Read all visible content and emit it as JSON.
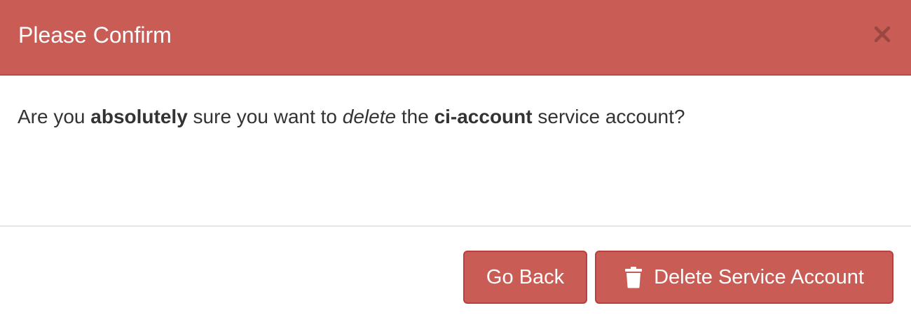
{
  "modal": {
    "title": "Please Confirm",
    "close_icon": "close-icon",
    "message": {
      "part1": "Are you ",
      "emphasis_strong": "absolutely",
      "part2": " sure you want to ",
      "emphasis_italic": "delete",
      "part3": " the ",
      "account_name": "ci-account",
      "part4": " service account?"
    },
    "buttons": {
      "back_label": "Go Back",
      "delete_label": "Delete Service Account",
      "delete_icon": "trash-icon"
    },
    "colors": {
      "header_bg": "#c95c55",
      "button_bg": "#c95c55",
      "text": "#333333"
    }
  }
}
